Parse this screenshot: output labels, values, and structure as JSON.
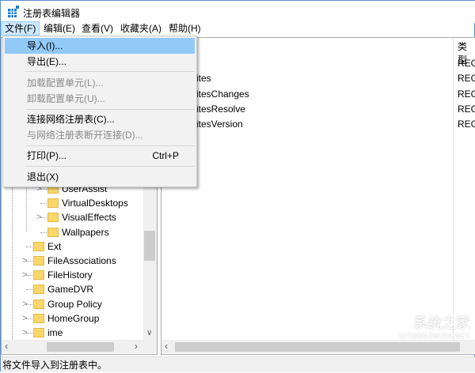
{
  "window": {
    "title": "注册表编辑器"
  },
  "menubar": [
    "文件(F)",
    "编辑(E)",
    "查看(V)",
    "收藏夹(A)",
    "帮助(H)"
  ],
  "file_menu": [
    {
      "label": "导入(I)...",
      "shortcut": "",
      "disabled": false,
      "highlighted": true
    },
    {
      "label": "导出(E)...",
      "shortcut": "",
      "disabled": false
    },
    {
      "label": "加载配置单元(L)...",
      "shortcut": "",
      "disabled": true
    },
    {
      "label": "卸载配置单元(U)...",
      "shortcut": "",
      "disabled": true
    },
    {
      "label": "连接网络注册表(C)...",
      "shortcut": "",
      "disabled": false
    },
    {
      "label": "与网络注册表断开连接(D)...",
      "shortcut": "",
      "disabled": true
    },
    {
      "label": "打印(P)...",
      "shortcut": "Ctrl+P",
      "disabled": false
    },
    {
      "label": "退出(X)",
      "shortcut": "",
      "disabled": false
    }
  ],
  "tree": [
    {
      "label": "UserAssist",
      "level": 2,
      "expandable": true
    },
    {
      "label": "VirtualDesktops",
      "level": 2,
      "expandable": false
    },
    {
      "label": "VisualEffects",
      "level": 2,
      "expandable": true
    },
    {
      "label": "Wallpapers",
      "level": 2,
      "expandable": false
    },
    {
      "label": "Ext",
      "level": 1,
      "expandable": false
    },
    {
      "label": "FileAssociations",
      "level": 1,
      "expandable": true
    },
    {
      "label": "FileHistory",
      "level": 1,
      "expandable": true
    },
    {
      "label": "GameDVR",
      "level": 1,
      "expandable": false
    },
    {
      "label": "Group Policy",
      "level": 1,
      "expandable": true
    },
    {
      "label": "HomeGroup",
      "level": 1,
      "expandable": true
    },
    {
      "label": "ime",
      "level": 1,
      "expandable": true
    }
  ],
  "values": {
    "type_header": "类型",
    "rows": [
      {
        "name": ")",
        "type": "REG"
      },
      {
        "name": "rites",
        "type": "REG"
      },
      {
        "name": "ritesChanges",
        "type": "REG"
      },
      {
        "name": "ritesResolve",
        "type": "REG"
      },
      {
        "name": "ritesVersion",
        "type": "REG"
      }
    ]
  },
  "status": "将文件导入到注册表中。",
  "watermark": {
    "text": "系统之家",
    "sub": "XITONGZHIJIA.NET"
  }
}
